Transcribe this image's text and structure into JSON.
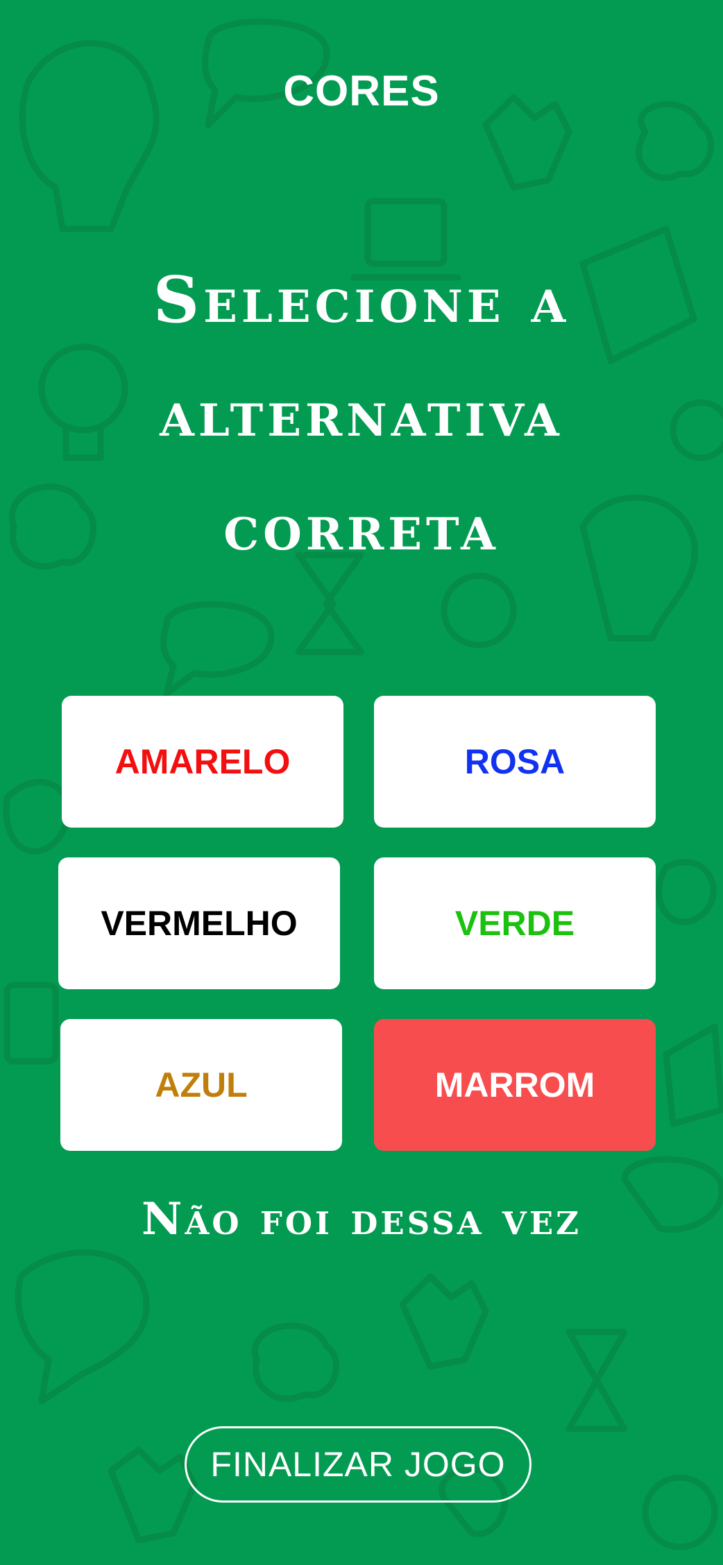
{
  "header": {
    "title": "CORES"
  },
  "prompt": {
    "text": "Selecione a alternativa correta"
  },
  "options": [
    {
      "label": "AMARELO",
      "color": "#f30f0f",
      "state": "default"
    },
    {
      "label": "ROSA",
      "color": "#1132f0",
      "state": "default"
    },
    {
      "label": "VERMELHO",
      "color": "#000000",
      "state": "default"
    },
    {
      "label": "VERDE",
      "color": "#1cc10f",
      "state": "default"
    },
    {
      "label": "AZUL",
      "color": "#c07f0a",
      "state": "default"
    },
    {
      "label": "MARROM",
      "color": "#ffffff",
      "state": "wrong"
    }
  ],
  "feedback": {
    "text": "Não foi dessa vez"
  },
  "footer": {
    "finish_label": "FINALIZAR JOGO"
  },
  "theme": {
    "background": "#039b51",
    "wrong_fill": "#f84d4f",
    "card_fill": "#ffffff"
  }
}
